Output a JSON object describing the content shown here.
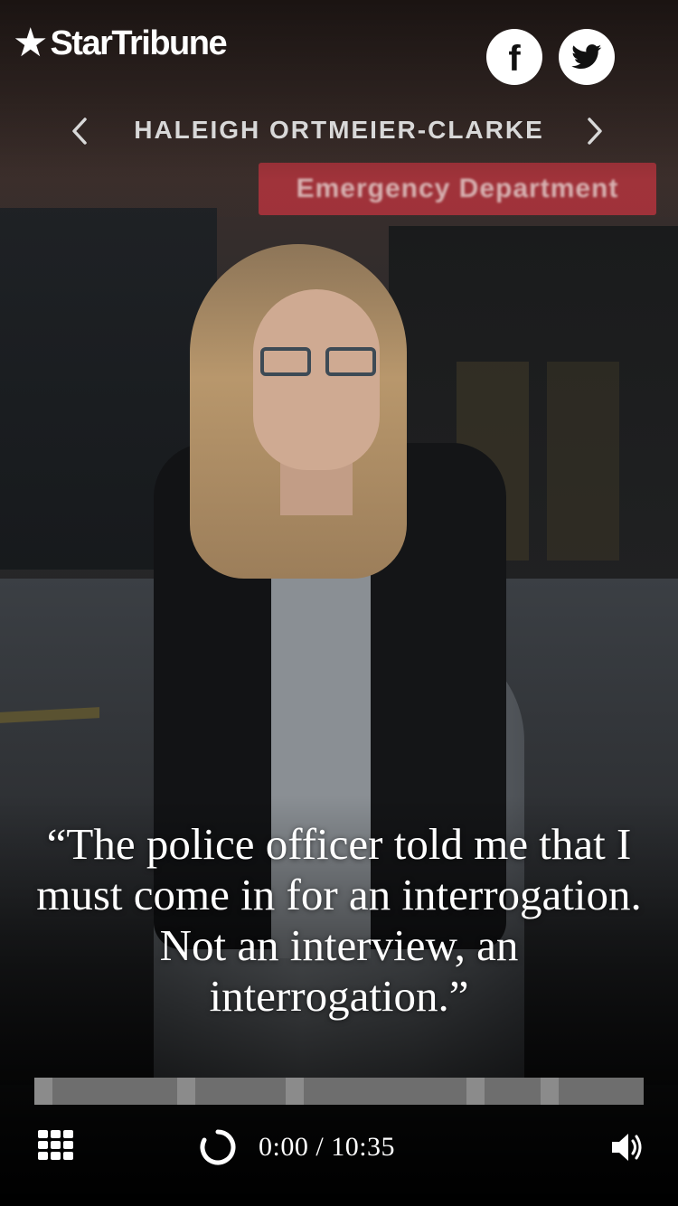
{
  "brand": {
    "name": "StarTribune"
  },
  "social": {
    "facebook_glyph": "f"
  },
  "nav": {
    "title": "HALEIGH ORTMEIER-CLARKE"
  },
  "background_sign": {
    "text": "Emergency Department"
  },
  "quote": {
    "text": "“The police officer told me that I must come in for an interrogation. Not an interview, an interrogation.”"
  },
  "player": {
    "current_time": "0:00",
    "separator": "/",
    "duration": "10:35",
    "progress_fraction": 0.0
  },
  "colors": {
    "accent_sign": "#b2343d",
    "progress_track": "#6e6e6e",
    "segment_marker": "#8b8b8b"
  },
  "icons": [
    "star-icon",
    "facebook-icon",
    "twitter-icon",
    "chevron-left-icon",
    "chevron-right-icon",
    "grid-icon",
    "loading-spinner-icon",
    "volume-icon"
  ]
}
